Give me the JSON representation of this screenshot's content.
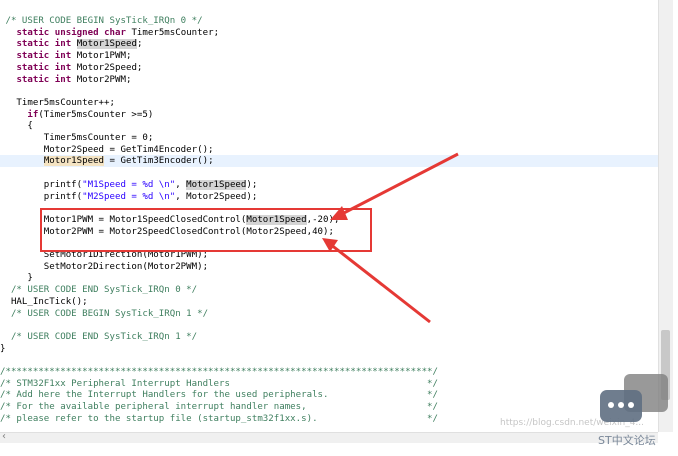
{
  "code": [
    {
      "segments": [
        {
          "t": " /* USER CODE BEGIN SysTick_IRQn 0 */",
          "c": "cmt"
        }
      ]
    },
    {
      "segments": [
        {
          "t": "   "
        },
        {
          "t": "static",
          "c": "kw"
        },
        {
          "t": " "
        },
        {
          "t": "unsigned",
          "c": "kw"
        },
        {
          "t": " "
        },
        {
          "t": "char",
          "c": "kw"
        },
        {
          "t": " Timer5msCounter;"
        }
      ]
    },
    {
      "segments": [
        {
          "t": "   "
        },
        {
          "t": "static",
          "c": "kw"
        },
        {
          "t": " "
        },
        {
          "t": "int",
          "c": "kw"
        },
        {
          "t": " "
        },
        {
          "t": "Motor1Speed",
          "c": "hl"
        },
        {
          "t": ";"
        }
      ]
    },
    {
      "segments": [
        {
          "t": "   "
        },
        {
          "t": "static",
          "c": "kw"
        },
        {
          "t": " "
        },
        {
          "t": "int",
          "c": "kw"
        },
        {
          "t": " Motor1PWM;"
        }
      ]
    },
    {
      "segments": [
        {
          "t": "   "
        },
        {
          "t": "static",
          "c": "kw"
        },
        {
          "t": " "
        },
        {
          "t": "int",
          "c": "kw"
        },
        {
          "t": " Motor2Speed;"
        }
      ]
    },
    {
      "segments": [
        {
          "t": "   "
        },
        {
          "t": "static",
          "c": "kw"
        },
        {
          "t": " "
        },
        {
          "t": "int",
          "c": "kw"
        },
        {
          "t": " Motor2PWM;"
        }
      ]
    },
    {
      "segments": [
        {
          "t": ""
        }
      ]
    },
    {
      "segments": [
        {
          "t": "   Timer5msCounter++;"
        }
      ]
    },
    {
      "segments": [
        {
          "t": "     "
        },
        {
          "t": "if",
          "c": "kw"
        },
        {
          "t": "(Timer5msCounter >=5)"
        }
      ]
    },
    {
      "segments": [
        {
          "t": "     {"
        }
      ]
    },
    {
      "segments": [
        {
          "t": "        Timer5msCounter = 0;"
        }
      ]
    },
    {
      "segments": [
        {
          "t": "        Motor2Speed = GetTim4Encoder();"
        }
      ]
    },
    {
      "current": true,
      "segments": [
        {
          "t": "        "
        },
        {
          "t": "Motor1Speed",
          "c": "hl2"
        },
        {
          "t": " = GetTim3Encoder();"
        }
      ]
    },
    {
      "segments": [
        {
          "t": ""
        }
      ]
    },
    {
      "segments": [
        {
          "t": "        printf("
        },
        {
          "t": "\"M1Speed = %d \\n\"",
          "c": "str"
        },
        {
          "t": ", "
        },
        {
          "t": "Motor1Speed",
          "c": "hl"
        },
        {
          "t": ");"
        }
      ]
    },
    {
      "segments": [
        {
          "t": "        printf("
        },
        {
          "t": "\"M2Speed = %d \\n\"",
          "c": "str"
        },
        {
          "t": ", Motor2Speed);"
        }
      ]
    },
    {
      "segments": [
        {
          "t": ""
        }
      ]
    },
    {
      "segments": [
        {
          "t": "        Motor1PWM = Motor1SpeedClosedControl("
        },
        {
          "t": "Motor1Speed",
          "c": "hl"
        },
        {
          "t": ",-20);"
        }
      ]
    },
    {
      "segments": [
        {
          "t": "        Motor2PWM = Motor2SpeedClosedControl(Motor2Speed,40);"
        }
      ]
    },
    {
      "segments": [
        {
          "t": ""
        }
      ]
    },
    {
      "segments": [
        {
          "t": "        SetMotor1Direction(Motor1PWM);"
        }
      ]
    },
    {
      "segments": [
        {
          "t": "        SetMotor2Direction(Motor2PWM);"
        }
      ]
    },
    {
      "segments": [
        {
          "t": "     }"
        }
      ]
    },
    {
      "segments": [
        {
          "t": "  /* USER CODE END SysTick_IRQn 0 */",
          "c": "cmt"
        }
      ]
    },
    {
      "segments": [
        {
          "t": "  HAL_IncTick();"
        }
      ]
    },
    {
      "segments": [
        {
          "t": "  /* USER CODE BEGIN SysTick_IRQn 1 */",
          "c": "cmt"
        }
      ]
    },
    {
      "segments": [
        {
          "t": ""
        }
      ]
    },
    {
      "segments": [
        {
          "t": "  /* USER CODE END SysTick_IRQn 1 */",
          "c": "cmt"
        }
      ]
    },
    {
      "segments": [
        {
          "t": "}"
        }
      ]
    },
    {
      "segments": [
        {
          "t": ""
        }
      ]
    },
    {
      "segments": [
        {
          "t": "/******************************************************************************/",
          "c": "cmt"
        }
      ]
    },
    {
      "segments": [
        {
          "t": "/* STM32F1xx Peripheral Interrupt Handlers                                    */",
          "c": "cmt"
        }
      ]
    },
    {
      "segments": [
        {
          "t": "/* Add here the Interrupt Handlers for the used peripherals.                  */",
          "c": "cmt"
        }
      ]
    },
    {
      "segments": [
        {
          "t": "/* For the available peripheral interrupt handler names,                      */",
          "c": "cmt"
        }
      ]
    },
    {
      "segments": [
        {
          "t": "/* please refer to the startup file (startup_stm32f1xx.s).                    */",
          "c": "cmt"
        }
      ]
    }
  ],
  "watermark": {
    "url": "https://blog.csdn.net/weixin_4...",
    "brand": "ST中文论坛"
  },
  "colors": {
    "highlight_box": "#e53935",
    "arrow": "#e53935"
  }
}
